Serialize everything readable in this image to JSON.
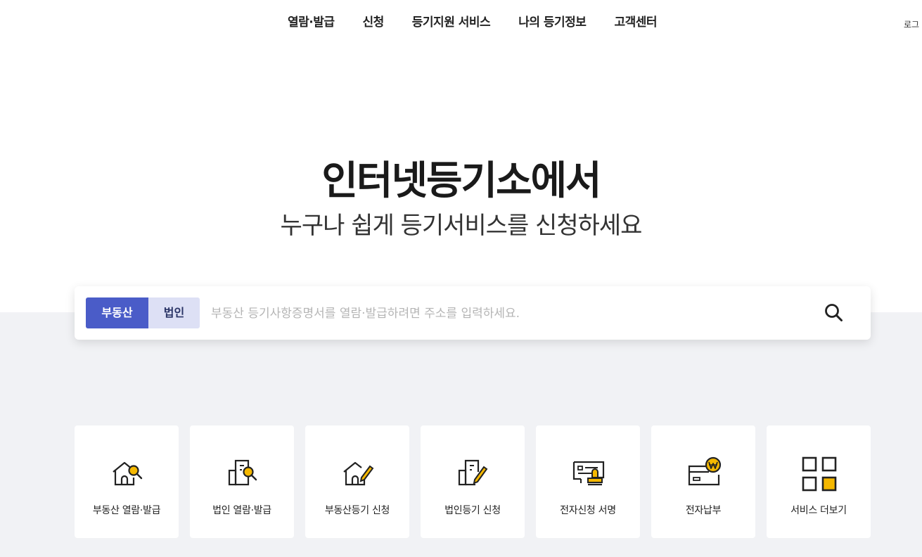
{
  "nav": {
    "items": [
      "열람·발급",
      "신청",
      "등기지원 서비스",
      "나의 등기정보",
      "고객센터"
    ],
    "login": "로그"
  },
  "hero": {
    "title": "인터넷등기소에서",
    "subtitle": "누구나 쉽게 등기서비스를 신청하세요"
  },
  "search": {
    "tabs": [
      "부동산",
      "법인"
    ],
    "active_tab": "부동산",
    "placeholder": "부동산 등기사항증명서를 열람·발급하려면 주소를 입력하세요.",
    "value": ""
  },
  "quick_menu": [
    {
      "label": "부동산 열람·발급",
      "icon": "house-search-icon"
    },
    {
      "label": "법인 열람·발급",
      "icon": "building-search-icon"
    },
    {
      "label": "부동산등기 신청",
      "icon": "house-pen-icon"
    },
    {
      "label": "법인등기 신청",
      "icon": "building-pen-icon"
    },
    {
      "label": "전자신청 서명",
      "icon": "document-stamp-icon"
    },
    {
      "label": "전자납부",
      "icon": "card-won-icon"
    },
    {
      "label": "서비스 더보기",
      "icon": "grid-more-icon"
    }
  ],
  "colors": {
    "accent": "#4a5cc8",
    "accent_light": "#dde0f5",
    "icon_yellow": "#f5b800",
    "band_bg": "#f1f2f5"
  }
}
